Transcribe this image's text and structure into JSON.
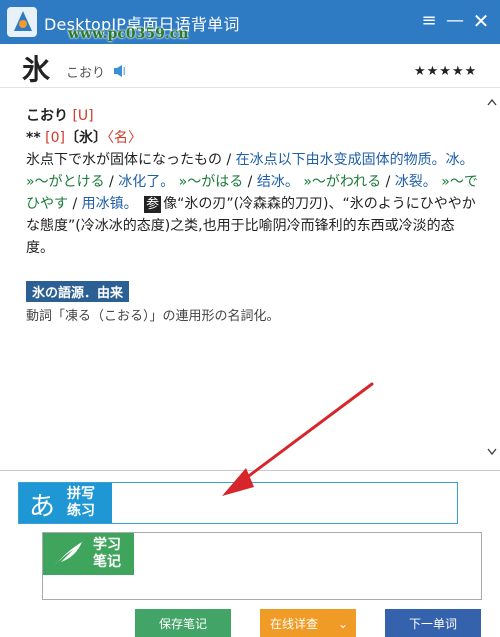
{
  "window": {
    "title": "DesktopJP桌面日语背单词",
    "watermark": "www.pc0359.cn",
    "menu_glyph": "≡",
    "min_glyph": "—",
    "close_glyph": "✕"
  },
  "word": {
    "headword": "氷",
    "reading": "こおり",
    "stars": "★★★★★"
  },
  "entry": {
    "kana": "こおり",
    "accent_u": "[U]",
    "stars_prefix": "**",
    "accent_0": "[0]",
    "kanji_bracket": "〔氷〕",
    "pos": "〈名〉",
    "def_ja": "氷点下で水が固体になったもの",
    "slash": " / ",
    "def_zh": "在冰点以下由水变成固体的物质。冰。",
    "ex1_ja": "»～がとける",
    "ex1_zh": "冰化了。",
    "ex2_ja": "»～がはる",
    "ex2_zh": "结冰。",
    "ex3_ja": "»～がわれる",
    "ex3_zh": "冰裂。",
    "ex4_ja": "»～でひやす",
    "ex4_zh": "用冰镇。",
    "ref_tag": "参",
    "ref_text": "像“氷の刃”(冷森森的刀刃)、“氷のようにひややかな態度”(冷冰冰的态度)之类,也用于比喻阴冷而锋利的东西或冷淡的态度。"
  },
  "etymology": {
    "title": "氷の語源．由来",
    "text": "動詞「凍る（こおる）」の連用形の名詞化。"
  },
  "spell": {
    "glyph": "あ",
    "label_line1": "拼写",
    "label_line2": "练习",
    "value": ""
  },
  "note": {
    "label_line1": "学习",
    "label_line2": "笔记",
    "value": ""
  },
  "buttons": {
    "save": "保存笔记",
    "online": "在线详查",
    "online_chevron": "⌄",
    "next": "下一单词"
  },
  "colors": {
    "titlebar": "#2e7bc3",
    "spell_blue": "#1f97d4",
    "note_green": "#3fa55d",
    "save_green": "#43a467",
    "online_orange": "#f19b27",
    "next_blue": "#3462ad",
    "arrow_red": "#d7262b"
  }
}
